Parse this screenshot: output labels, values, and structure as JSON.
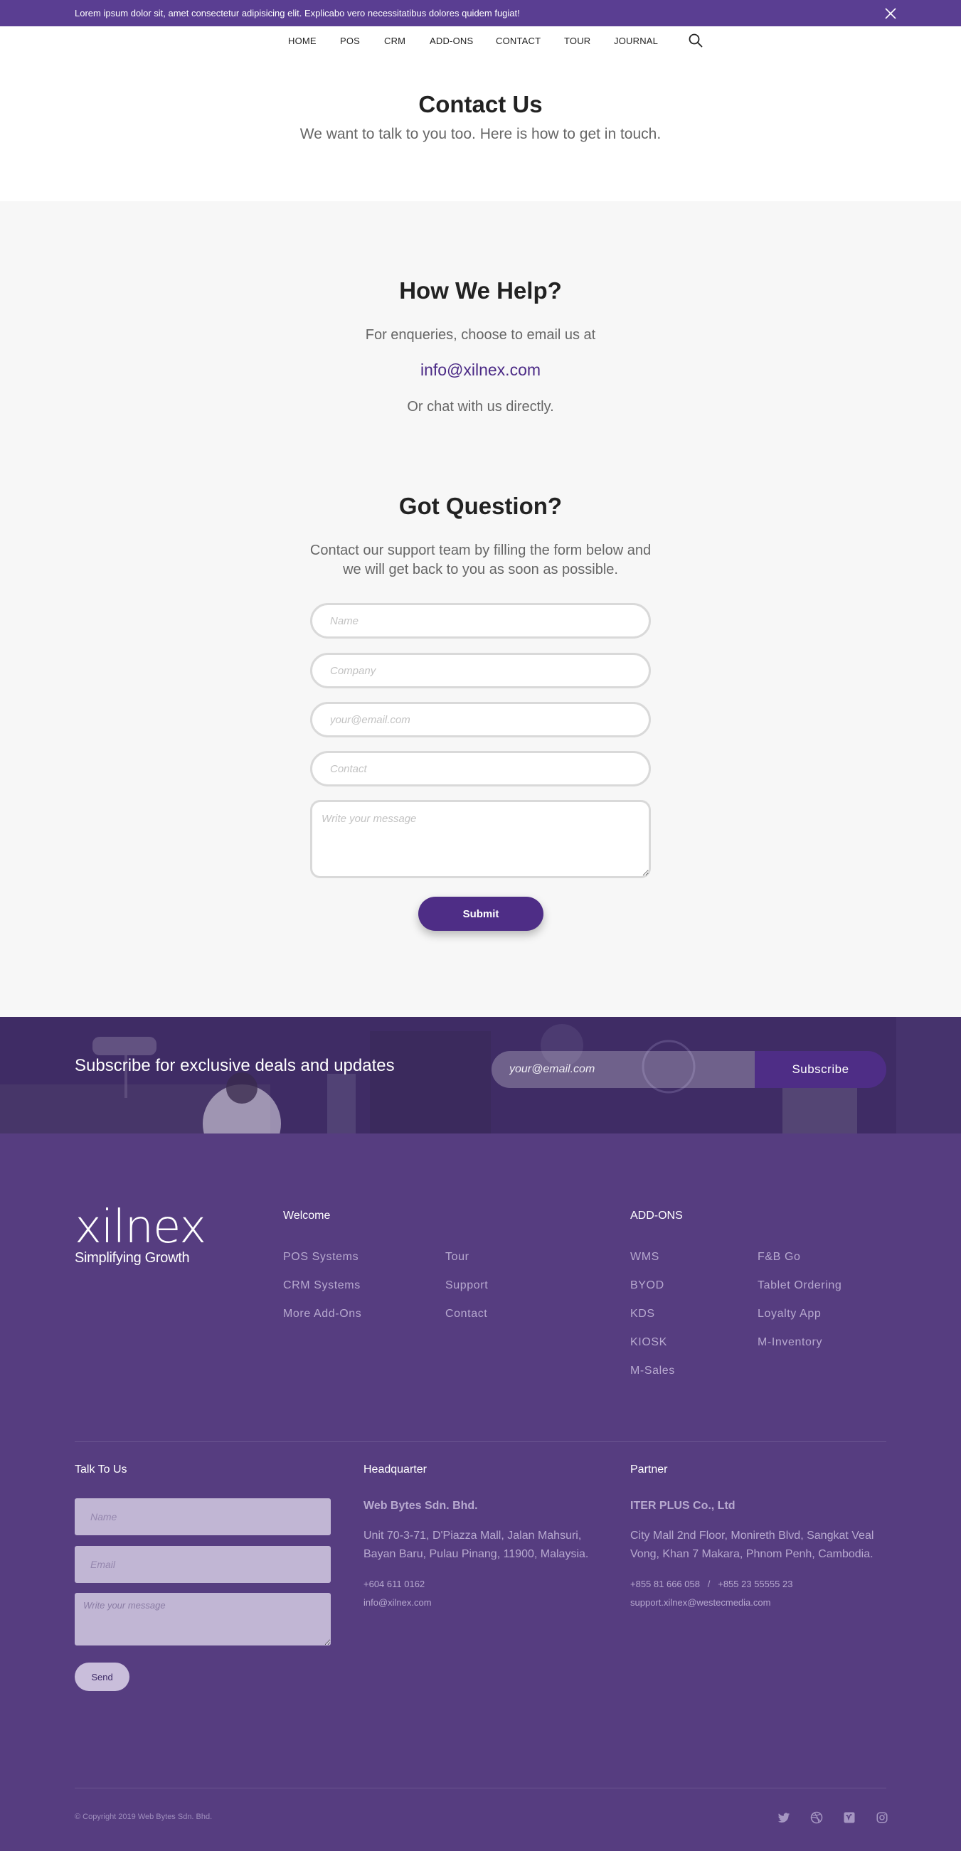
{
  "announcement": {
    "text": "Lorem ipsum dolor sit, amet consectetur adipisicing elit. Explicabo vero necessitatibus dolores quidem fugiat!"
  },
  "nav": {
    "items": [
      "HOME",
      "POS",
      "CRM",
      "ADD-ONS",
      "CONTACT",
      "TOUR",
      "JOURNAL"
    ]
  },
  "header": {
    "title": "Contact Us",
    "subtitle": "We want to talk to you too. Here is how to get in touch."
  },
  "help": {
    "title": "How We Help?",
    "line1": "For enqueries, choose to email us at",
    "email": "info@xilnex.com",
    "line2": "Or chat with us directly."
  },
  "question": {
    "title": "Got Question?",
    "line1": "Contact our support team by filling the form below and",
    "line2": "we will get back to you as soon as possible.",
    "placeholders": {
      "name": "Name",
      "company": "Company",
      "email": "your@email.com",
      "contact": "Contact",
      "message": "Write your message"
    },
    "submit": "Submit"
  },
  "subscribe": {
    "title": "Subscribe for exclusive deals and updates",
    "placeholder": "your@email.com",
    "button": "Subscribe"
  },
  "footer": {
    "logo": {
      "word": "xilnex",
      "tagline": "Simplifying Growth"
    },
    "welcome": {
      "heading": "Welcome",
      "col1": [
        "POS Systems",
        "CRM Systems",
        "More Add-Ons"
      ],
      "col2": [
        "Tour",
        "Support",
        "Contact"
      ]
    },
    "addons": {
      "heading": "ADD-ONS",
      "col1": [
        "WMS",
        "BYOD",
        "KDS",
        "KIOSK",
        "M-Sales"
      ],
      "col2": [
        "F&B Go",
        "Tablet Ordering",
        "Loyalty App",
        "M-Inventory"
      ]
    },
    "talk": {
      "heading": "Talk To Us",
      "placeholders": {
        "name": "Name",
        "email": "Email",
        "message": "Write your message"
      },
      "send": "Send"
    },
    "hq": {
      "heading": "Headquarter",
      "name": "Web Bytes Sdn. Bhd.",
      "addr1": "Unit 70-3-71, D'Piazza Mall, Jalan Mahsuri,",
      "addr2": "Bayan Baru, Pulau Pinang, 11900, Malaysia.",
      "phone": "+604 611 0162",
      "email": "info@xilnex.com"
    },
    "partner": {
      "heading": "Partner",
      "name": "ITER PLUS Co., Ltd",
      "addr1": "City Mall 2nd Floor, Monireth Blvd, Sangkat Veal",
      "addr2": "Vong, Khan 7 Makara, Phnom Penh, Cambodia.",
      "phones": "+855 81 666 058   /   +855 23 55555 23",
      "email": "support.xilnex@westecmedia.com"
    },
    "copyright": "© Copyright 2019 Web Bytes Sdn. Bhd.",
    "social": [
      "twitter-icon",
      "dribbble-icon",
      "vimeo-icon",
      "instagram-icon"
    ]
  },
  "colors": {
    "brand_purple": "#5a3e92",
    "button_purple": "#4e2d86",
    "footer_bg": "#563d80",
    "link_purple": "#4b2a86"
  }
}
